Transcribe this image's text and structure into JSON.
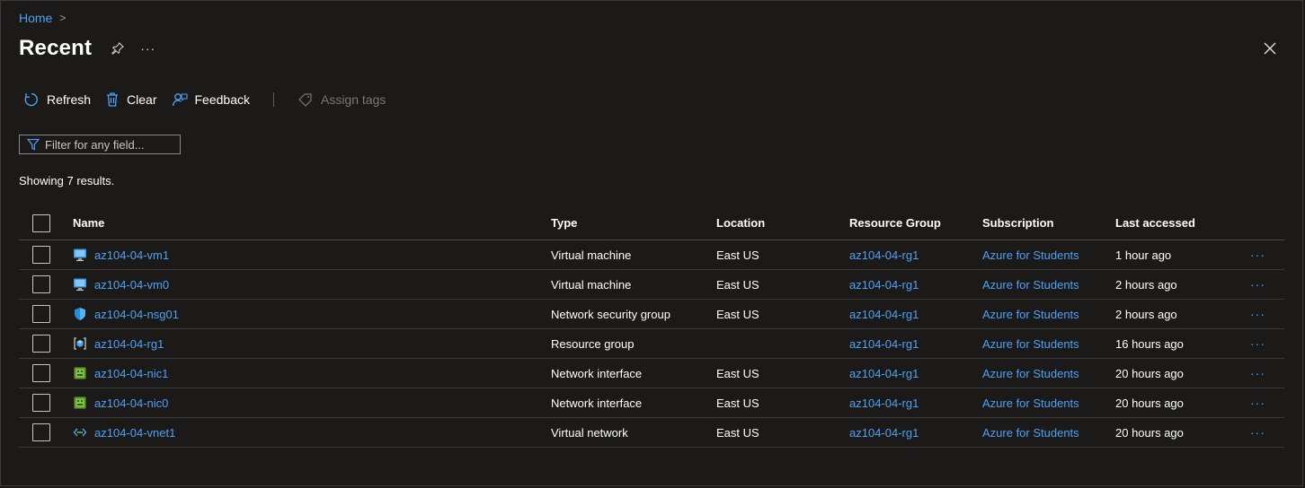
{
  "breadcrumb": {
    "home": "Home",
    "separator": ">"
  },
  "page": {
    "title": "Recent",
    "more": "···"
  },
  "toolbar": {
    "refresh": "Refresh",
    "clear": "Clear",
    "feedback": "Feedback",
    "assign_tags": "Assign tags"
  },
  "filter": {
    "placeholder": "Filter for any field..."
  },
  "results_text": "Showing 7 results.",
  "table": {
    "columns": [
      "Name",
      "Type",
      "Location",
      "Resource Group",
      "Subscription",
      "Last accessed"
    ],
    "rows": [
      {
        "name": "az104-04-vm1",
        "icon": "virtual-machine-icon",
        "type": "Virtual machine",
        "location": "East US",
        "resource_group": "az104-04-rg1",
        "subscription": "Azure for Students",
        "last_accessed": "1 hour ago",
        "more": "···"
      },
      {
        "name": "az104-04-vm0",
        "icon": "virtual-machine-icon",
        "type": "Virtual machine",
        "location": "East US",
        "resource_group": "az104-04-rg1",
        "subscription": "Azure for Students",
        "last_accessed": "2 hours ago",
        "more": "···"
      },
      {
        "name": "az104-04-nsg01",
        "icon": "shield-icon",
        "type": "Network security group",
        "location": "East US",
        "resource_group": "az104-04-rg1",
        "subscription": "Azure for Students",
        "last_accessed": "2 hours ago",
        "more": "···"
      },
      {
        "name": "az104-04-rg1",
        "icon": "resource-group-icon",
        "type": "Resource group",
        "location": "",
        "resource_group": "az104-04-rg1",
        "subscription": "Azure for Students",
        "last_accessed": "16 hours ago",
        "more": "···"
      },
      {
        "name": "az104-04-nic1",
        "icon": "network-interface-icon",
        "type": "Network interface",
        "location": "East US",
        "resource_group": "az104-04-rg1",
        "subscription": "Azure for Students",
        "last_accessed": "20 hours ago",
        "more": "···"
      },
      {
        "name": "az104-04-nic0",
        "icon": "network-interface-icon",
        "type": "Network interface",
        "location": "East US",
        "resource_group": "az104-04-rg1",
        "subscription": "Azure for Students",
        "last_accessed": "20 hours ago",
        "more": "···"
      },
      {
        "name": "az104-04-vnet1",
        "icon": "virtual-network-icon",
        "type": "Virtual network",
        "location": "East US",
        "resource_group": "az104-04-rg1",
        "subscription": "Azure for Students",
        "last_accessed": "20 hours ago",
        "more": "···"
      }
    ]
  },
  "colors": {
    "link": "#4ea1f5",
    "background": "#1b1a19"
  }
}
